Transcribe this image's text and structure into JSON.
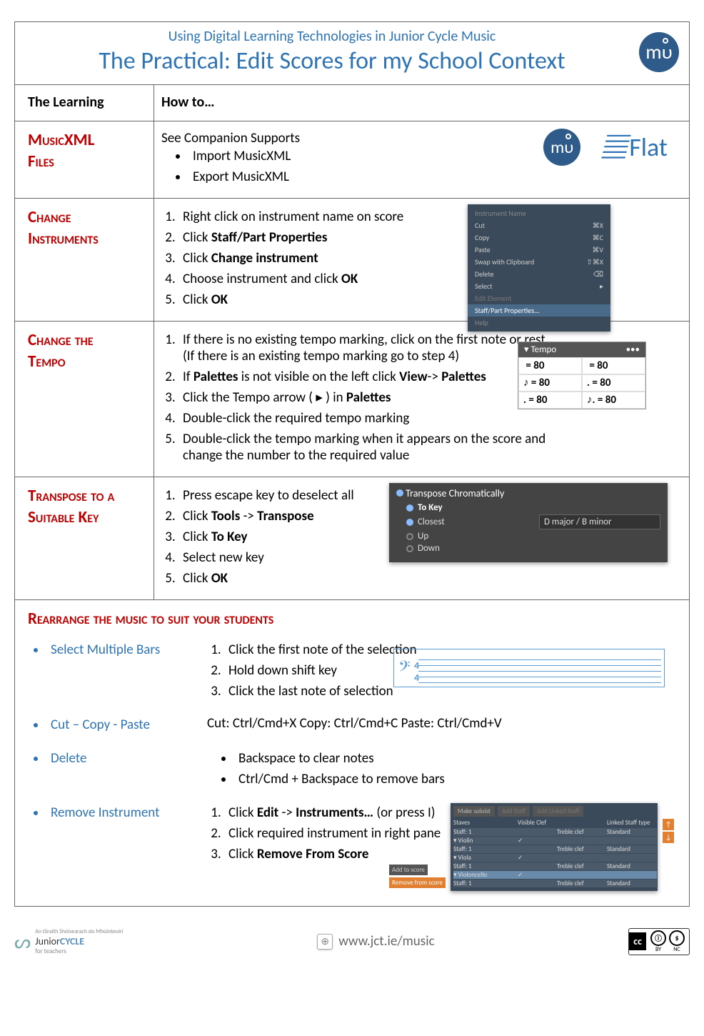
{
  "banner": {
    "supertitle": "Using Digital Learning Technologies in Junior Cycle Music",
    "title": "The Practical: Edit Scores for my School Context",
    "app_logo_text": "mυ"
  },
  "header_row": {
    "left": "The Learning",
    "right": "How to…"
  },
  "flat_logo_text": "Flat",
  "sections": {
    "musicxml": {
      "heading_a": "MusicXML",
      "heading_b": "Files",
      "intro": "See Companion Supports",
      "bullets": [
        "Import MusicXML",
        "Export MusicXML"
      ]
    },
    "change_instruments": {
      "heading_a": "Change",
      "heading_b": "Instruments",
      "steps_pre": [
        "Right click on instrument name on score"
      ],
      "steps_bold": [
        {
          "pre": "Click ",
          "b": "Staff/Part Properties"
        },
        {
          "pre": "Click ",
          "b": "Change instrument"
        }
      ],
      "steps_post": [
        {
          "pre": "Choose instrument and click ",
          "b": "OK"
        },
        {
          "pre": "Click ",
          "b": "OK"
        }
      ],
      "ctx": {
        "title": "Instrument Name",
        "items": [
          {
            "l": "Cut",
            "r": "⌘X"
          },
          {
            "l": "Copy",
            "r": "⌘C"
          },
          {
            "l": "Paste",
            "r": "⌘V"
          },
          {
            "l": "Swap with Clipboard",
            "r": "⇧⌘X"
          },
          {
            "l": "Delete",
            "r": "⌫"
          },
          {
            "l": "Select",
            "r": "▸"
          }
        ],
        "dim_items": [
          "Edit Element"
        ],
        "hl": "Staff/Part Properties...",
        "last": "Help"
      }
    },
    "change_tempo": {
      "heading_a": "Change the",
      "heading_b": "Tempo",
      "steps": [
        "If there is no existing tempo marking, click on the first note or rest (If there is an existing tempo marking go to step 4)",
        {
          "t": "If ",
          "b1": "Palettes",
          "t2": " is not visible on the left click ",
          "b2": "View",
          "t3": "-> ",
          "b3": "Palettes"
        },
        {
          "t": "Click the Tempo arrow ( ▸ ) in ",
          "b1": "Palettes"
        },
        "Double-click the required tempo marking",
        "Double-click the tempo marking when it appears on the score and change the number to the required value"
      ],
      "palette_hdr": "Tempo",
      "palette_cells": [
        "♩ = 80",
        "♩ = 80",
        "♪ = 80",
        "♩. = 80",
        "♩. = 80",
        "♪. = 80"
      ]
    },
    "transpose": {
      "heading_a": "Transpose to a",
      "heading_b": "Suitable Key",
      "steps": [
        "Press escape key to deselect all",
        {
          "t": "Click ",
          "b1": "Tools",
          "t2": " -> ",
          "b2": "Transpose"
        },
        {
          "t": "Click ",
          "b1": "To Key"
        },
        "Select new key",
        {
          "t": "Click ",
          "b1": "OK"
        }
      ],
      "dlg": {
        "title": "Transpose Chromatically",
        "to_key": "To Key",
        "closest": "Closest",
        "up": "Up",
        "down": "Down",
        "key": "D major / B minor"
      }
    },
    "rearrange": {
      "heading": "Rearrange the music to suit your students",
      "items": [
        {
          "label": "Select Multiple Bars",
          "steps": [
            "Click the first note of the selection",
            "Hold down shift key",
            "Click the last note of selection"
          ]
        },
        {
          "label": "Cut – Copy - Paste",
          "text": "Cut: Ctrl/Cmd+X   Copy: Ctrl/Cmd+C  Paste: Ctrl/Cmd+V"
        },
        {
          "label": "Delete",
          "bullets": [
            "Backspace to clear notes",
            "Ctrl/Cmd + Backspace to remove bars"
          ]
        },
        {
          "label": "Remove Instrument",
          "steps_rich": [
            {
              "t": "Click ",
              "b1": "Edit",
              "t2": " -> ",
              "b2": "Instruments…",
              "t3": " (or press I)"
            },
            {
              "t": "Click required instrument in right pane"
            },
            {
              "t": "Click ",
              "b1": "Remove From Score"
            }
          ]
        }
      ],
      "inst_dlg": {
        "top": [
          "Make soloist",
          "Add Staff",
          "Add Linked Staff"
        ],
        "hdr": [
          "Staves",
          "Visible Clef",
          "",
          "Linked Staff type"
        ],
        "rows": [
          {
            "a": "Staff: 1",
            "b": "",
            "c": "Treble clef",
            "d": "Standard"
          },
          {
            "a": "▾ Violin",
            "b": "✓",
            "c": "",
            "d": ""
          },
          {
            "a": "Staff: 1",
            "b": "",
            "c": "Treble clef",
            "d": "Standard"
          },
          {
            "a": "▾ Viola",
            "b": "✓",
            "c": "",
            "d": ""
          },
          {
            "a": "Staff: 1",
            "b": "",
            "c": "Treble clef",
            "d": "Standard"
          },
          {
            "a": "▾ Violoncello",
            "b": "✓",
            "c": "",
            "d": "",
            "sel": true
          },
          {
            "a": "Staff: 1",
            "b": "",
            "c": "Treble clef",
            "d": "Standard"
          }
        ],
        "side": [
          "Add to score",
          "Remove from score"
        ]
      }
    }
  },
  "footer": {
    "jc_l1": "An tSraith Shóisearach do Mhúinteoirí",
    "jc_l2a": "Junior",
    "jc_l2b": "CYCLE",
    "jc_l3": "for teachers",
    "url": "www.jct.ie/music",
    "cc": "cc",
    "cc_by": "BY",
    "cc_nc": "NC"
  }
}
